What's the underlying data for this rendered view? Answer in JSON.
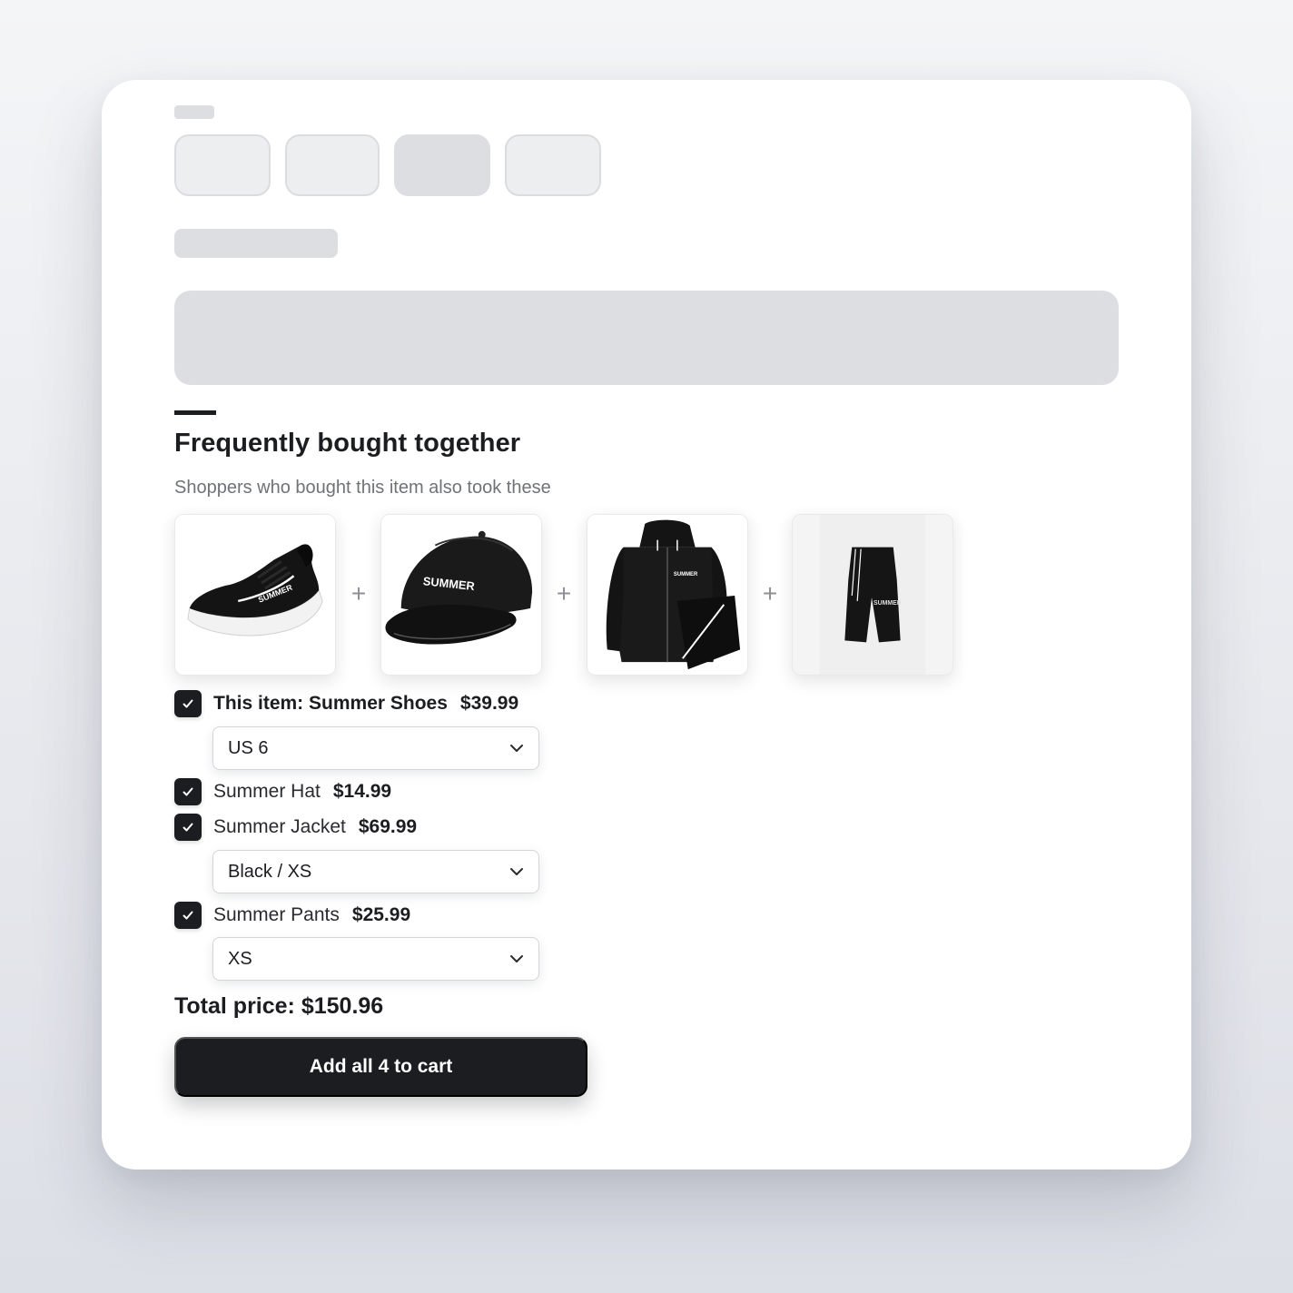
{
  "section": {
    "title": "Frequently bought together",
    "subtitle": "Shoppers who bought this item also took these"
  },
  "products": [
    {
      "image_icon": "sneaker-image",
      "logo_text": "SUMMER"
    },
    {
      "image_icon": "cap-image",
      "logo_text": "SUMMER"
    },
    {
      "image_icon": "jacket-image",
      "logo_text": "SUMMER"
    },
    {
      "image_icon": "shorts-image",
      "logo_text": "SUMMER"
    }
  ],
  "separator": "+",
  "items": [
    {
      "name": "This item: Summer Shoes",
      "price": "$39.99",
      "checked": true,
      "option": "US 6"
    },
    {
      "name": "Summer Hat",
      "price": "$14.99",
      "checked": true
    },
    {
      "name": "Summer Jacket",
      "price": "$69.99",
      "checked": true,
      "option": "Black / XS"
    },
    {
      "name": "Summer Pants",
      "price": "$25.99",
      "checked": true,
      "option": "XS"
    }
  ],
  "total": {
    "label": "Total price:",
    "value": "$150.96"
  },
  "cart_button": {
    "label": "Add all 4 to cart"
  },
  "colors": {
    "primary": "#1c1d20",
    "muted_text": "#6f7277",
    "skeleton": "#dcdee2",
    "background": "#eef0f3"
  }
}
